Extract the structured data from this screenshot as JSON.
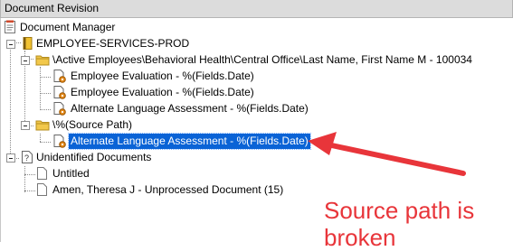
{
  "window": {
    "title": "Document Revision"
  },
  "tree": {
    "root": {
      "label": "Document Manager",
      "icon": "document-manager-icon"
    },
    "prod": {
      "label": "EMPLOYEE-SERVICES-PROD",
      "icon": "binder-icon"
    },
    "folder1": {
      "label": "\\Active Employees\\Behavioral Health\\Central Office\\Last Name, First Name M - 100034",
      "icon": "folder-icon",
      "items": [
        {
          "label": "Employee Evaluation - %(Fields.Date)",
          "icon": "document-gear-icon"
        },
        {
          "label": "Employee Evaluation - %(Fields.Date)",
          "icon": "document-gear-icon"
        },
        {
          "label": "Alternate Language Assessment - %(Fields.Date)",
          "icon": "document-gear-icon"
        }
      ]
    },
    "folder2": {
      "label": "\\%(Source Path)",
      "icon": "folder-icon",
      "items": [
        {
          "label": "Alternate Language Assessment - %(Fields.Date)",
          "icon": "document-gear-icon",
          "selected": true
        }
      ]
    },
    "unidentified": {
      "label": "Unidentified Documents",
      "icon": "question-document-icon",
      "items": [
        {
          "label": "Untitled",
          "icon": "blank-document-icon"
        },
        {
          "label": "Amen, Theresa J - Unprocessed Document (15)",
          "icon": "blank-document-icon"
        }
      ]
    }
  },
  "annotation": {
    "text": "Source path is broken",
    "color": "#e8353a"
  },
  "colors": {
    "selection": "#0a63d6",
    "folder": "#f2c84b"
  }
}
